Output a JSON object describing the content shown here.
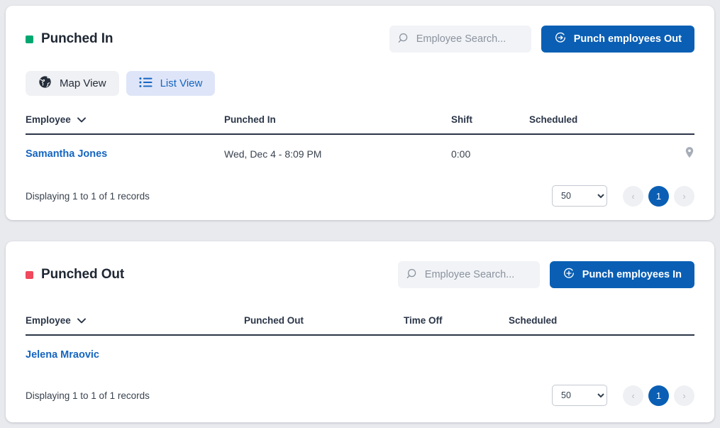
{
  "panels": [
    {
      "status_color": "#00a870",
      "title": "Punched In",
      "search": {
        "placeholder": "Employee Search...",
        "value": "",
        "icon": "search-icon"
      },
      "action_button": {
        "label": "Punch employees Out",
        "icon": "sign-out-circle-icon",
        "color": "#0a5fb4"
      },
      "view_toggle": [
        {
          "label": "Map View",
          "icon": "globe-icon",
          "active": false
        },
        {
          "label": "List View",
          "icon": "list-icon",
          "active": true
        }
      ],
      "columns": [
        "Employee",
        "Punched In",
        "Shift",
        "Scheduled",
        ""
      ],
      "rows": [
        {
          "employee": "Samantha Jones",
          "punched": "Wed, Dec 4 - 8:09 PM",
          "shift": "0:00",
          "scheduled": "",
          "pin_icon": "map-pin-icon"
        }
      ],
      "footer": {
        "records_text": "Displaying 1 to 1 of 1 records",
        "page_size": "50",
        "page_size_options": [
          "50"
        ],
        "prev_label": "‹",
        "next_label": "›",
        "current_page": "1"
      }
    },
    {
      "status_color": "#f0485c",
      "title": "Punched Out",
      "search": {
        "placeholder": "Employee Search...",
        "value": "",
        "icon": "search-icon"
      },
      "action_button": {
        "label": "Punch employees In",
        "icon": "sign-in-circle-icon",
        "color": "#0a5fb4"
      },
      "columns": [
        "Employee",
        "Punched Out",
        "Time Off",
        "Scheduled",
        ""
      ],
      "rows": [
        {
          "employee": "Jelena Mraovic",
          "punched": "",
          "timeoff": "",
          "scheduled": ""
        }
      ],
      "footer": {
        "records_text": "Displaying 1 to 1 of 1 records",
        "page_size": "50",
        "page_size_options": [
          "50"
        ],
        "prev_label": "‹",
        "next_label": "›",
        "current_page": "1"
      }
    }
  ]
}
